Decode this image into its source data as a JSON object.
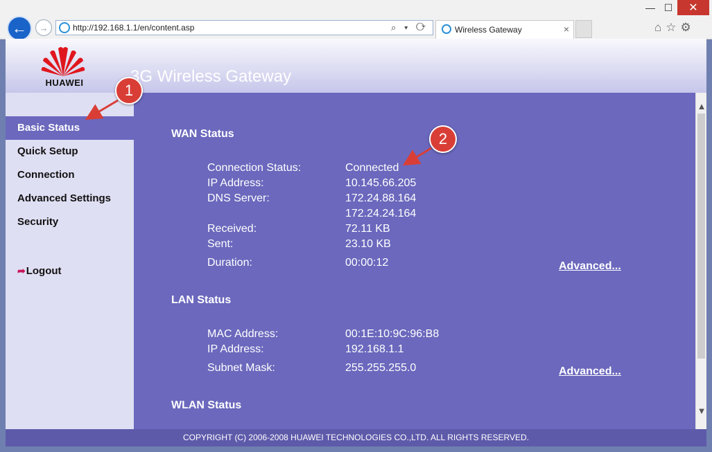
{
  "browser": {
    "url": "http://192.168.1.1/en/content.asp",
    "tab_title": "Wireless Gateway",
    "tab_close": "×",
    "min_label": "—",
    "max_label": "☐",
    "close_label": "✕",
    "addr_tools": "⌕ ▾ ⟳",
    "right_icons": "⌂☆⚙"
  },
  "header": {
    "brand": "HUAWEI",
    "title": "3G Wireless Gateway"
  },
  "sidebar": {
    "items": [
      {
        "label": "Basic Status",
        "active": true
      },
      {
        "label": "Quick Setup"
      },
      {
        "label": "Connection"
      },
      {
        "label": "Advanced Settings"
      },
      {
        "label": "Security"
      }
    ],
    "logout": "Logout"
  },
  "wan": {
    "title": "WAN Status",
    "connection_status_label": "Connection Status:",
    "connection_status": "Connected",
    "ip_label": "IP Address:",
    "ip": "10.145.66.205",
    "dns_label": "DNS Server:",
    "dns1": "172.24.88.164",
    "dns2": "172.24.24.164",
    "received_label": "Received:",
    "received": "72.11 KB",
    "sent_label": "Sent:",
    "sent": "23.10 KB",
    "duration_label": "Duration:",
    "duration": "00:00:12",
    "advanced": "Advanced..."
  },
  "lan": {
    "title": "LAN Status",
    "mac_label": "MAC Address:",
    "mac": "00:1E:10:9C:96:B8",
    "ip_label": "IP Address:",
    "ip": "192.168.1.1",
    "mask_label": "Subnet Mask:",
    "mask": "255.255.255.0",
    "advanced": "Advanced..."
  },
  "wlan": {
    "title": "WLAN Status"
  },
  "footer": {
    "copyright": "COPYRIGHT (C) 2006-2008 HUAWEI TECHNOLOGIES CO.,LTD. ALL RIGHTS RESERVED."
  },
  "annotations": {
    "badge1": "1",
    "badge2": "2",
    "color": "#d93e36"
  },
  "colors": {
    "page_bg": "#6b68bd",
    "sidebar_bg": "#dfdff4",
    "footer_bg": "#5e5aaa"
  }
}
